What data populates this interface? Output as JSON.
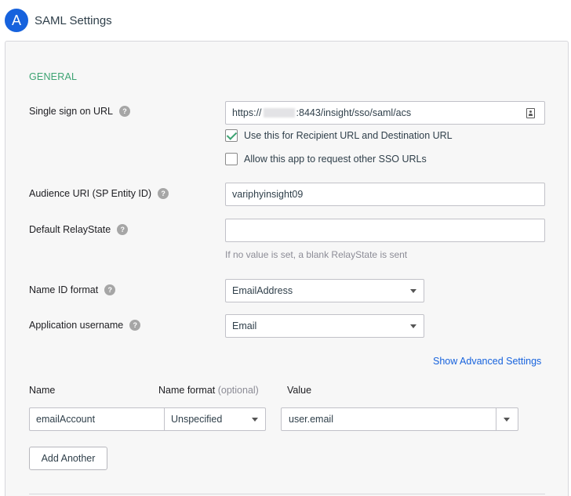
{
  "header": {
    "badge": "A",
    "title": "SAML Settings"
  },
  "general": {
    "section_label": "GENERAL",
    "sso_url": {
      "label": "Single sign on URL",
      "value_prefix": "https://",
      "value_suffix": ":8443/insight/sso/saml/acs",
      "icon": "contact-card-icon"
    },
    "use_recipient": {
      "label": "Use this for Recipient URL and Destination URL",
      "checked": true
    },
    "allow_other_sso": {
      "label": "Allow this app to request other SSO URLs",
      "checked": false
    },
    "audience_uri": {
      "label": "Audience URI (SP Entity ID)",
      "value": "variphyinsight09"
    },
    "relay_state": {
      "label": "Default RelayState",
      "value": "",
      "hint": "If no value is set, a blank RelayState is sent"
    },
    "name_id_format": {
      "label": "Name ID format",
      "selected": "EmailAddress"
    },
    "app_username": {
      "label": "Application username",
      "selected": "Email"
    },
    "advanced_link": "Show Advanced Settings"
  },
  "attributes": {
    "headers": {
      "name": "Name",
      "format": "Name format",
      "format_note": "(optional)",
      "value": "Value"
    },
    "rows": [
      {
        "name": "emailAccount",
        "format": "Unspecified",
        "value": "user.email"
      }
    ],
    "add_button": "Add Another"
  },
  "colors": {
    "accent_blue": "#1662dd",
    "section_green": "#3ca372",
    "help_gray": "#a6a6a6"
  }
}
